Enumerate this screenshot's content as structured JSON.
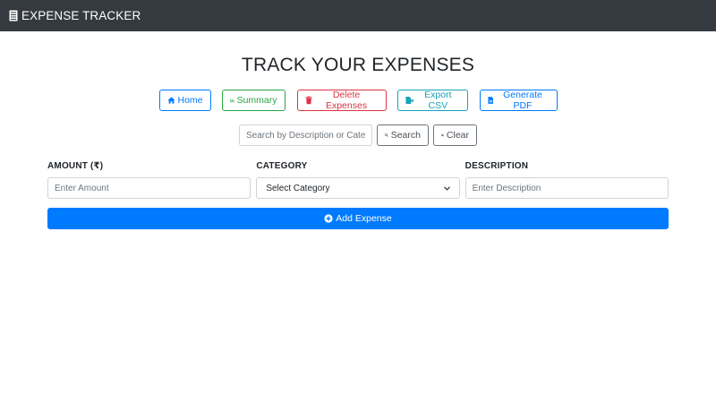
{
  "navbar": {
    "brand_icon": "document-list-icon",
    "brand": "EXPENSE TRACKER"
  },
  "page": {
    "title": "TRACK YOUR EXPENSES"
  },
  "actions": {
    "home": {
      "label": "Home",
      "icon": "home-icon",
      "color": "#007bff"
    },
    "summary": {
      "label": "Summary",
      "icon": "chart-icon",
      "color": "#28a745"
    },
    "delete": {
      "label": "Delete Expenses",
      "icon": "trash-icon",
      "color": "#dc3545"
    },
    "export": {
      "label": "Export CSV",
      "icon": "file-export-icon",
      "color": "#17a2b8"
    },
    "pdf": {
      "label": "Generate PDF",
      "icon": "file-pdf-icon",
      "color": "#007bff"
    }
  },
  "search": {
    "placeholder": "Search by Description or Category",
    "value": "",
    "search_label": "Search",
    "clear_label": "Clear"
  },
  "form": {
    "amount_label": "AMOUNT (₹)",
    "amount_placeholder": "Enter Amount",
    "category_label": "CATEGORY",
    "category_selected": "Select Category",
    "description_label": "DESCRIPTION",
    "description_placeholder": "Enter Description",
    "submit_label": "Add Expense"
  },
  "colors": {
    "navbar_bg": "#343a40",
    "primary": "#007bff"
  }
}
